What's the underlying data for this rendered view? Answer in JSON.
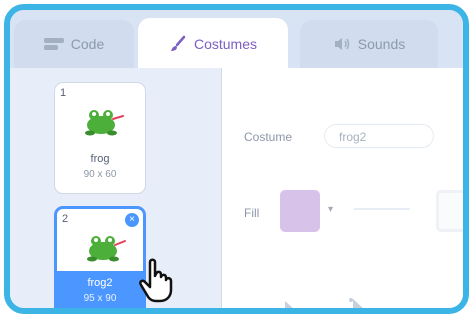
{
  "tabs": {
    "code_label": "Code",
    "costumes_label": "Costumes",
    "sounds_label": "Sounds"
  },
  "costumes": [
    {
      "number": "1",
      "name": "frog",
      "size": "90 x 60"
    },
    {
      "number": "2",
      "name": "frog2",
      "size": "95 x 90"
    }
  ],
  "editor": {
    "costume_label": "Costume",
    "costume_name_value": "frog2",
    "fill_label": "Fill",
    "fill_color": "#d7c3ea"
  },
  "colors": {
    "frame_border": "#3db4e6",
    "selected_blue": "#4c97ff",
    "frog_green": "#4caf3a"
  },
  "icons": [
    "code-icon",
    "paintbrush-icon",
    "speaker-icon",
    "delete-icon",
    "select-tool-icon",
    "reshape-tool-icon",
    "hand-pointer-cursor"
  ]
}
